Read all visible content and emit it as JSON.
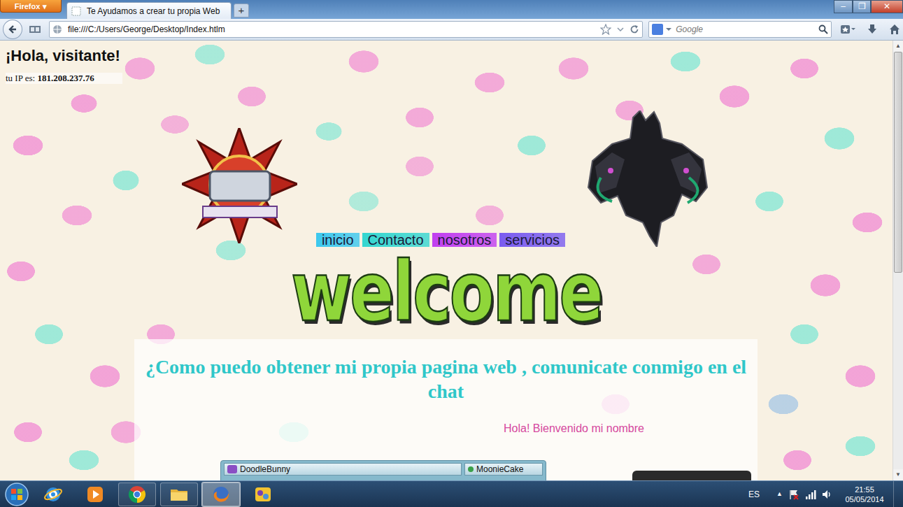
{
  "browser": {
    "menu_button": "Firefox",
    "menu_arrow": "▾",
    "tabs": [
      {
        "label": "Te Ayudamos a crear tu propia Web",
        "selected": true
      }
    ],
    "new_tab": "+",
    "window_controls": [
      "–",
      "❐",
      "✕"
    ],
    "address": "file:///C:/Users/George/Desktop/Index.htlm",
    "search": {
      "placeholder": "Google"
    },
    "scrollbar": {
      "arrows": [
        "▲",
        "▼"
      ],
      "level": 0.53
    }
  },
  "page": {
    "greeting": "¡Hola, visitante!",
    "ip_label": "tu IP es:",
    "ip": "181.208.237.76",
    "nav": [
      {
        "label": "inicio",
        "color": "#3cc8ee"
      },
      {
        "label": "Contacto",
        "color": "#35d6d0"
      },
      {
        "label": "nosotros",
        "color": "#c13ff0"
      },
      {
        "label": "servicios",
        "color": "#7a5cf0"
      }
    ],
    "banner": "welcome",
    "heading": "¿Como puedo obtener mi propia pagina web , comunicate conmigo en el chat",
    "chat_greeting": "Hola! Bienvenido mi nombre",
    "chat_users": [
      "DoodleBunny",
      "MoonieCake"
    ]
  },
  "taskbar": {
    "apps": [
      {
        "kind": "ie",
        "open": false,
        "selected": false
      },
      {
        "kind": "media",
        "open": false,
        "selected": false
      },
      {
        "kind": "chrome",
        "open": true,
        "selected": false
      },
      {
        "kind": "explorer",
        "open": true,
        "selected": false
      },
      {
        "kind": "firefox",
        "open": true,
        "selected": true
      },
      {
        "kind": "app",
        "open": false,
        "selected": false
      }
    ],
    "tray_arrow": "▲",
    "language": "ES",
    "time": "21:55",
    "date": "05/05/2014"
  }
}
